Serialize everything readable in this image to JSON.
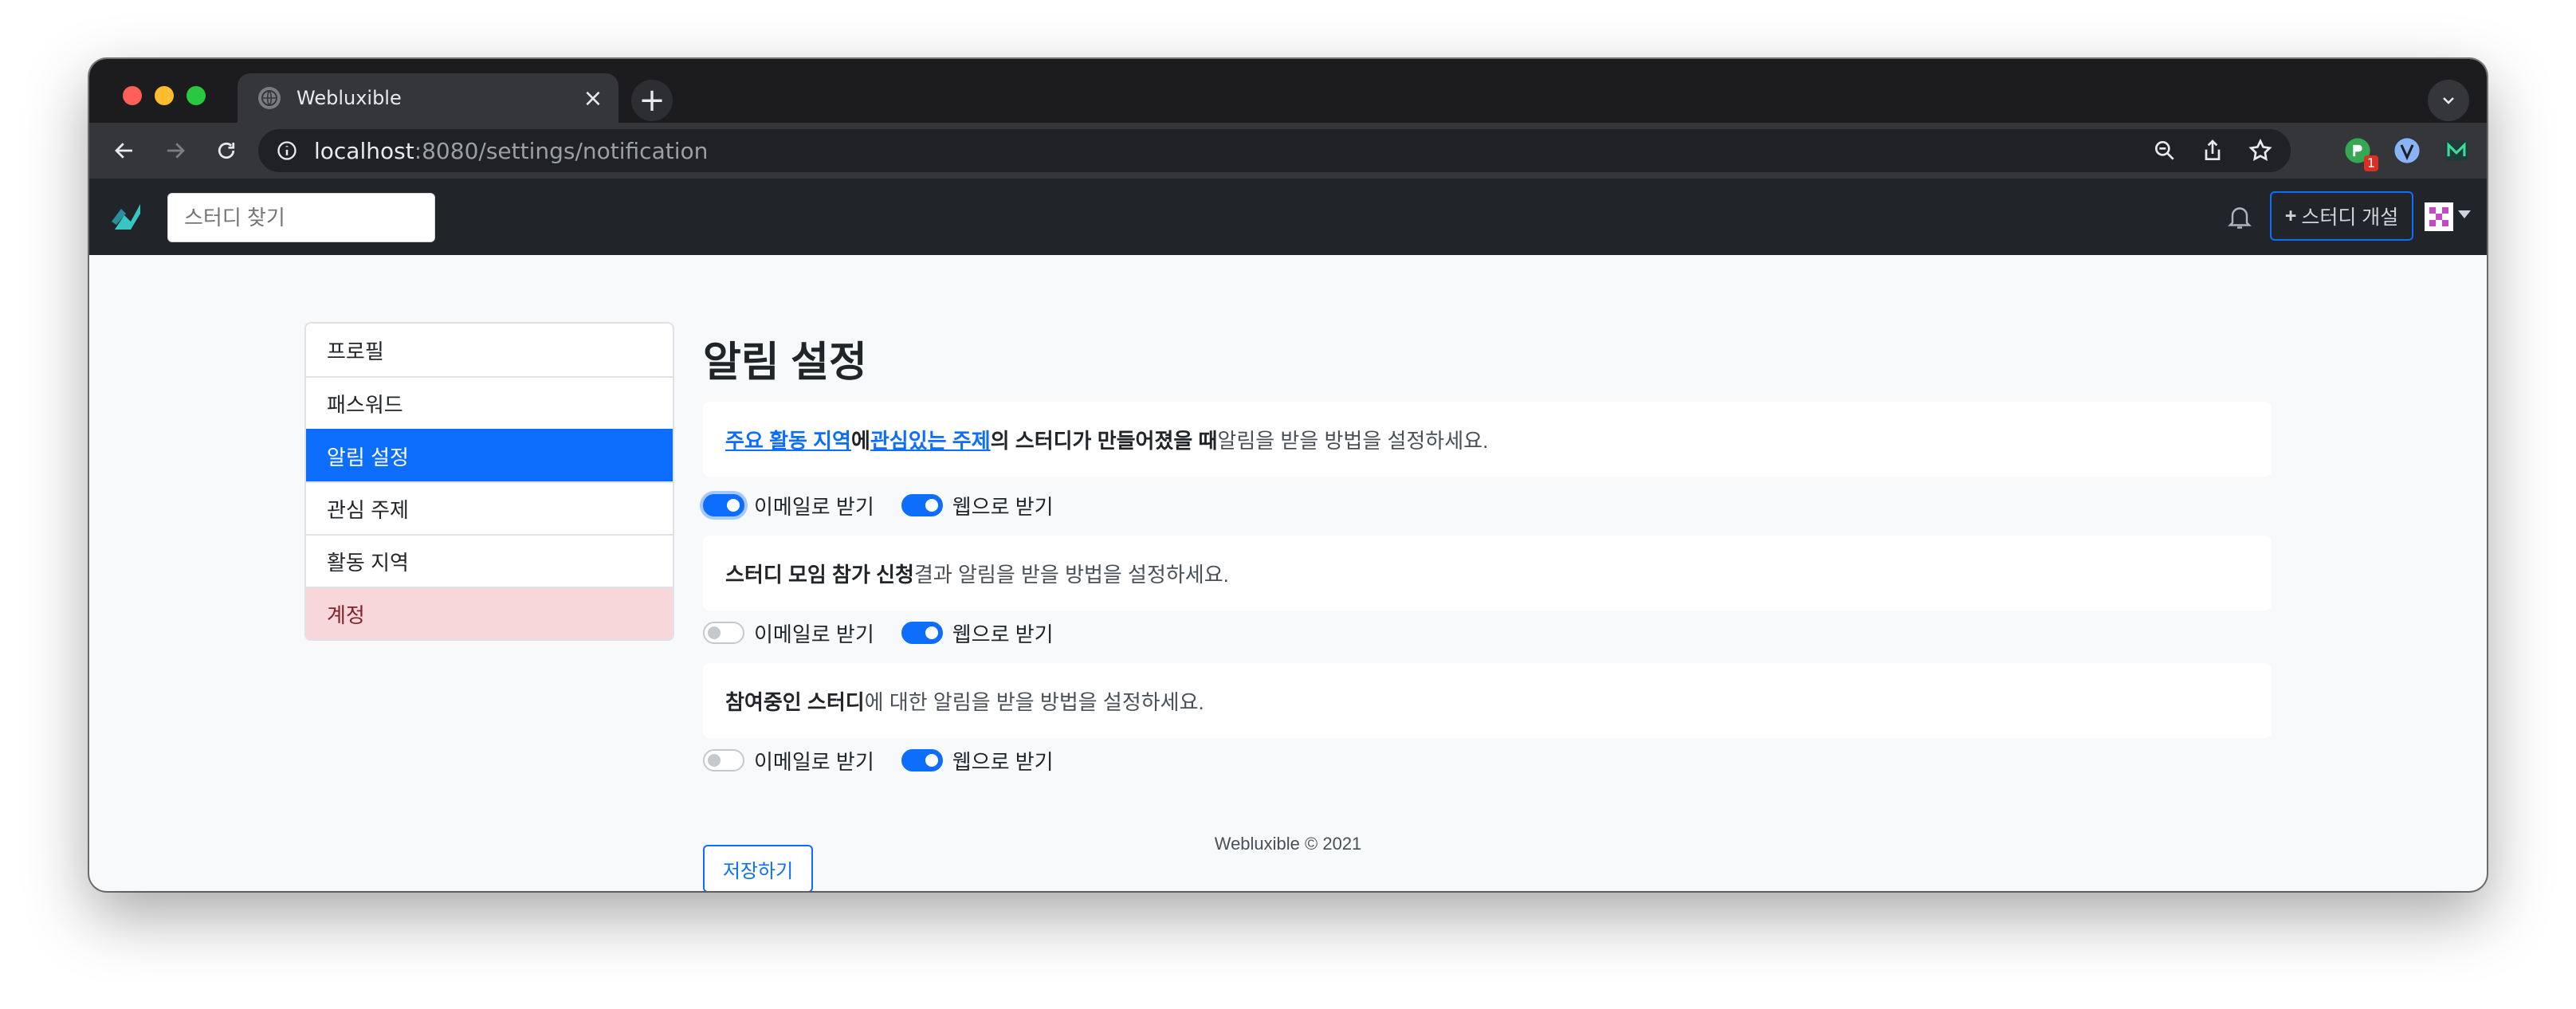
{
  "browser": {
    "tab_title": "Webluxible",
    "url_host": "localhost",
    "url_path": ":8080/settings/notification",
    "extension_badge": "1"
  },
  "site": {
    "search_placeholder": "스터디 찾기",
    "new_study_label": "스터디 개설"
  },
  "sidebar": {
    "items": [
      {
        "label": "프로필"
      },
      {
        "label": "패스워드"
      },
      {
        "label": "알림 설정"
      },
      {
        "label": "관심 주제"
      },
      {
        "label": "활동 지역"
      },
      {
        "label": "계정"
      }
    ]
  },
  "main": {
    "title": "알림 설정",
    "section1": {
      "link1": "주요 활동 지역",
      "text1": "에 ",
      "link2": "관심있는 주제",
      "bold": "의 스터디가 만들어졌을 때",
      "rest": " 알림을 받을 방법을 설정하세요.",
      "email_label": "이메일로 받기",
      "web_label": "웹으로 받기"
    },
    "section2": {
      "bold": "스터디 모임 참가 신청",
      "rest": " 결과 알림을 받을 방법을 설정하세요.",
      "email_label": "이메일로 받기",
      "web_label": "웹으로 받기"
    },
    "section3": {
      "bold": "참여중인 스터디",
      "rest": "에 대한 알림을 받을 방법을 설정하세요.",
      "email_label": "이메일로 받기",
      "web_label": "웹으로 받기"
    },
    "save_label": "저장하기"
  },
  "footer": {
    "text": "Webluxible © 2021"
  }
}
